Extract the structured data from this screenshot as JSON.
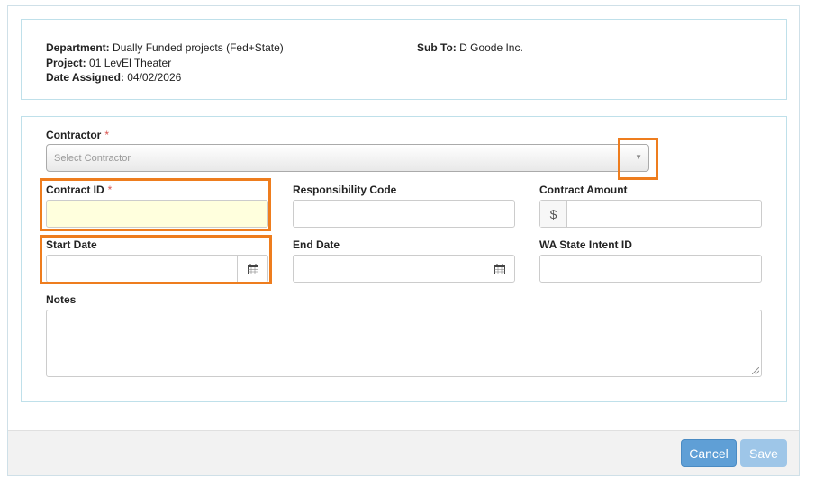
{
  "header": {
    "department_label": "Department:",
    "department_value": "Dually Funded projects (Fed+State)",
    "project_label": "Project:",
    "project_value": "01 LevEl Theater",
    "date_assigned_label": "Date Assigned:",
    "date_assigned_value": "04/02/2026",
    "sub_to_label": "Sub To:",
    "sub_to_value": "D Goode Inc."
  },
  "form": {
    "contractor_label": "Contractor",
    "required_mark": "*",
    "contractor_placeholder": "Select Contractor",
    "contract_id_label": "Contract ID",
    "contract_id_value": "",
    "responsibility_code_label": "Responsibility Code",
    "responsibility_code_value": "",
    "contract_amount_label": "Contract Amount",
    "currency_symbol": "$",
    "contract_amount_value": "",
    "start_date_label": "Start Date",
    "start_date_value": "",
    "end_date_label": "End Date",
    "end_date_value": "",
    "wa_state_intent_label": "WA State Intent ID",
    "wa_state_intent_value": "",
    "notes_label": "Notes",
    "notes_value": ""
  },
  "footer": {
    "cancel_label": "Cancel",
    "save_label": "Save"
  },
  "colors": {
    "highlight": "#ee7d1e",
    "cancel_button": "#5f9fd6",
    "save_button_disabled": "#9ec6e8",
    "required": "#d9534f",
    "focused_input": "#ffffdd"
  }
}
